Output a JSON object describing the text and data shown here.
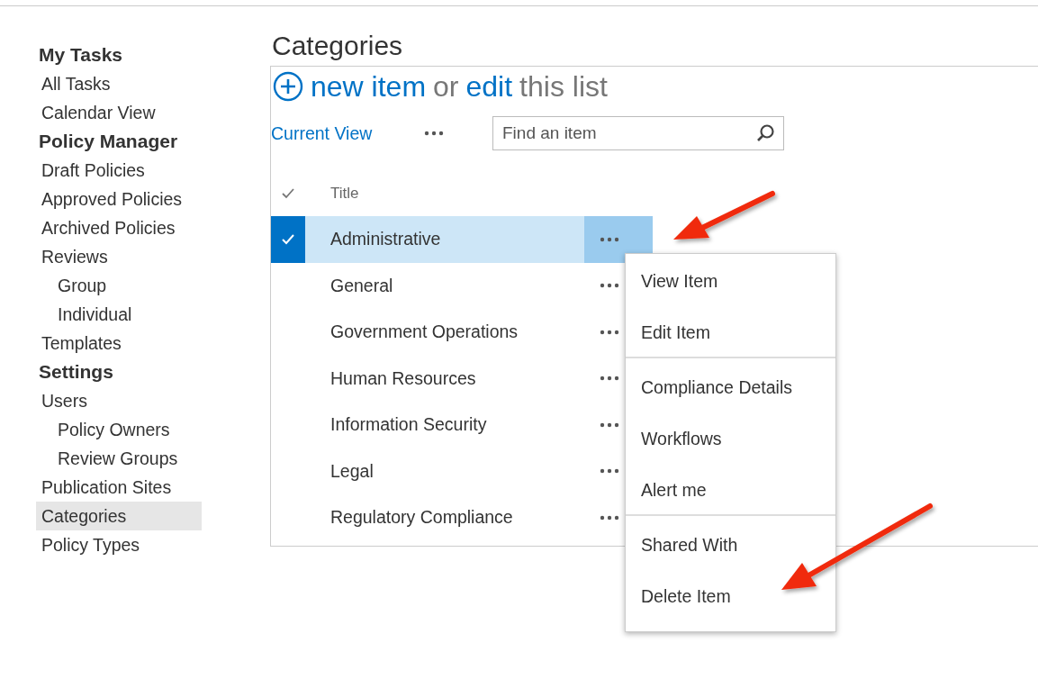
{
  "sidebar": {
    "sections": [
      {
        "heading": "My Tasks",
        "items": [
          {
            "label": "All Tasks",
            "selected": false
          },
          {
            "label": "Calendar View",
            "selected": false
          }
        ]
      },
      {
        "heading": "Policy Manager",
        "items": [
          {
            "label": "Draft Policies",
            "selected": false
          },
          {
            "label": "Approved Policies",
            "selected": false
          },
          {
            "label": "Archived Policies",
            "selected": false
          },
          {
            "label": "Reviews",
            "selected": false,
            "children": [
              {
                "label": "Group",
                "selected": false
              },
              {
                "label": "Individual",
                "selected": false
              }
            ]
          },
          {
            "label": "Templates",
            "selected": false
          }
        ]
      },
      {
        "heading": "Settings",
        "items": [
          {
            "label": "Users",
            "selected": false,
            "children": [
              {
                "label": "Policy Owners",
                "selected": false
              },
              {
                "label": "Review Groups",
                "selected": false
              }
            ]
          },
          {
            "label": "Publication Sites",
            "selected": false
          },
          {
            "label": "Categories",
            "selected": true
          },
          {
            "label": "Policy Types",
            "selected": false
          }
        ]
      }
    ]
  },
  "page_title": "Categories",
  "command": {
    "new_link": "new item",
    "or": "or",
    "edit_link": "edit",
    "rest": "this list"
  },
  "view": {
    "current_view": "Current View",
    "search": {
      "placeholder": "Find an item"
    }
  },
  "table": {
    "columns": [
      "Title"
    ],
    "rows": [
      {
        "title": "Administrative",
        "selected": true
      },
      {
        "title": "General",
        "selected": false
      },
      {
        "title": "Government Operations",
        "selected": false
      },
      {
        "title": "Human Resources",
        "selected": false
      },
      {
        "title": "Information Security",
        "selected": false
      },
      {
        "title": "Legal",
        "selected": false
      },
      {
        "title": "Regulatory Compliance",
        "selected": false
      }
    ]
  },
  "context_menu": {
    "groups": [
      [
        "View Item",
        "Edit Item"
      ],
      [
        "Compliance Details",
        "Workflows",
        "Alert me"
      ],
      [
        "Shared With",
        "Delete Item"
      ]
    ]
  }
}
